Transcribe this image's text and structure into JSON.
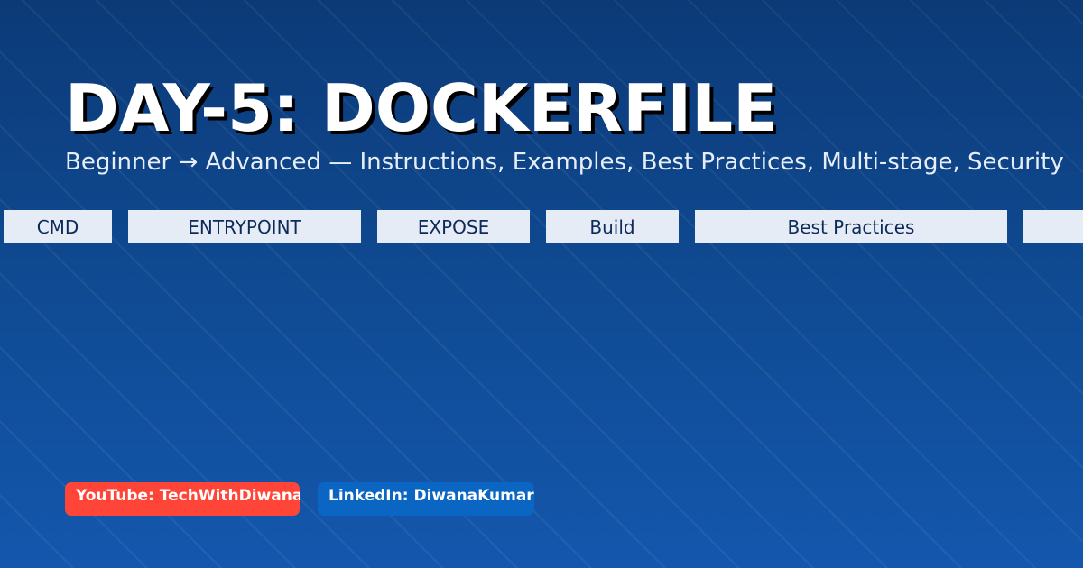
{
  "title": "DAY-5: DOCKERFILE",
  "subtitle": "Beginner → Advanced — Instructions, Examples, Best Practices, Multi-stage, Security",
  "chips": [
    "CMD",
    "ENTRYPOINT",
    "EXPOSE",
    "Build",
    "Best Practices",
    ""
  ],
  "badges": {
    "youtube": "YouTube: TechWithDiwana",
    "linkedin": "LinkedIn: DiwanaKumar"
  },
  "colors": {
    "youtube": "#ff4538",
    "linkedin": "#0a66c2",
    "chip_bg": "#e6ecf5"
  }
}
